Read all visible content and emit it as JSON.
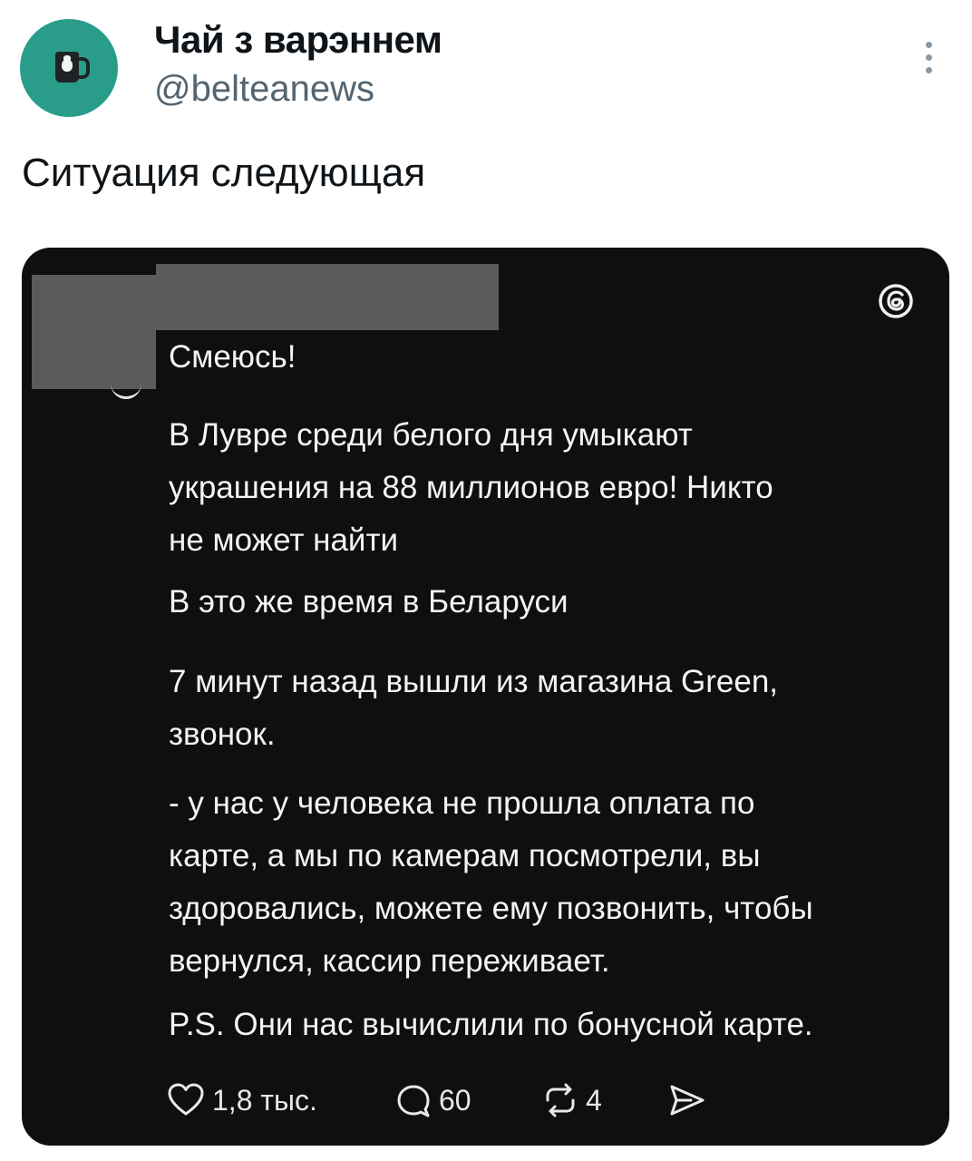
{
  "tweet": {
    "author": {
      "display_name": "Чай з варэннем",
      "handle": "@belteanews"
    },
    "text": "Ситуация следующая"
  },
  "embedded_post": {
    "lines": {
      "first": "Смеюсь!",
      "p1": [
        "В Лувре среди белого дня умыкают",
        "украшения на 88 миллионов евро! Никто",
        "не может найти"
      ],
      "p2": "В это же время в Беларуси",
      "p3": [
        "7 минут назад вышли из магазина Green,",
        "звонок."
      ],
      "p4": [
        "- у нас у человека не прошла оплата по",
        "карте, а мы по камерам посмотрели, вы",
        "здоровались, можете ему позвонить, чтобы",
        "вернулся, кассир переживает."
      ],
      "p5": "P.S. Они нас вычислили по бонусной карте."
    },
    "actions": {
      "likes": "1,8 тыс.",
      "replies": "60",
      "reposts": "4"
    }
  },
  "icons": {
    "more": "more-vertical-icon",
    "threads": "threads-logo-icon",
    "like": "heart-icon",
    "reply": "comment-bubble-icon",
    "repost": "repost-icon",
    "share": "share-arrow-icon"
  },
  "colors": {
    "avatar_bg": "#2a9d8a",
    "card_bg": "#0f0f0f",
    "redaction": "#5b5b5b",
    "handle_text": "#536471"
  }
}
